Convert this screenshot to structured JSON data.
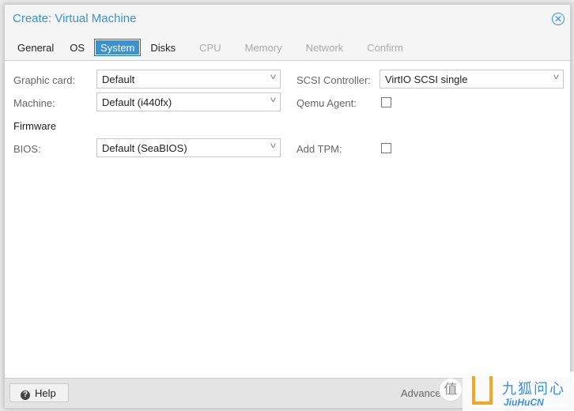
{
  "dialog": {
    "title": "Create: Virtual Machine"
  },
  "tabs": [
    {
      "label": "General",
      "state": "enabled"
    },
    {
      "label": "OS",
      "state": "enabled"
    },
    {
      "label": "System",
      "state": "active"
    },
    {
      "label": "Disks",
      "state": "enabled"
    },
    {
      "label": "CPU",
      "state": "disabled"
    },
    {
      "label": "Memory",
      "state": "disabled"
    },
    {
      "label": "Network",
      "state": "disabled"
    },
    {
      "label": "Confirm",
      "state": "disabled"
    }
  ],
  "form": {
    "graphic_card": {
      "label": "Graphic card:",
      "value": "Default"
    },
    "machine": {
      "label": "Machine:",
      "value": "Default (i440fx)"
    },
    "firmware_heading": "Firmware",
    "bios": {
      "label": "BIOS:",
      "value": "Default (SeaBIOS)"
    },
    "scsi_controller": {
      "label": "SCSI Controller:",
      "value": "VirtIO SCSI single"
    },
    "qemu_agent": {
      "label": "Qemu Agent:",
      "checked": false
    },
    "add_tpm": {
      "label": "Add TPM:",
      "checked": false
    }
  },
  "footer": {
    "help_label": "Help",
    "advanced_label": "Advance"
  },
  "watermark": {
    "seal": "值",
    "brand_cn": "九狐问心",
    "brand_en": "JiuHuCN"
  },
  "colors": {
    "accent": "#3892d4"
  }
}
